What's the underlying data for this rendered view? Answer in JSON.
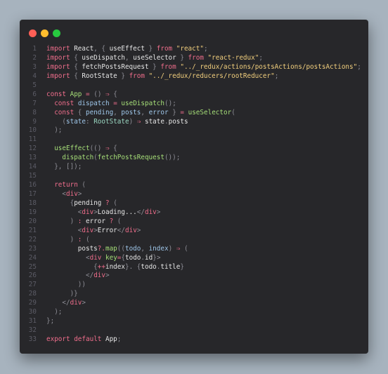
{
  "window": {
    "controls": [
      {
        "name": "close",
        "color": "#ff5f56"
      },
      {
        "name": "minimize",
        "color": "#ffbd2e"
      },
      {
        "name": "maximize",
        "color": "#27c93f"
      }
    ]
  },
  "code": {
    "lines": [
      {
        "n": "1",
        "tokens": [
          [
            "kw",
            "import"
          ],
          [
            "txt",
            " React"
          ],
          [
            "pun",
            ", { "
          ],
          [
            "txt",
            "useEffect"
          ],
          [
            "pun",
            " } "
          ],
          [
            "kw",
            "from"
          ],
          [
            "pun",
            " "
          ],
          [
            "str",
            "\"react\""
          ],
          [
            "pun",
            ";"
          ]
        ]
      },
      {
        "n": "2",
        "tokens": [
          [
            "kw",
            "import"
          ],
          [
            "pun",
            " { "
          ],
          [
            "txt",
            "useDispatch"
          ],
          [
            "pun",
            ", "
          ],
          [
            "txt",
            "useSelector"
          ],
          [
            "pun",
            " } "
          ],
          [
            "kw",
            "from"
          ],
          [
            "pun",
            " "
          ],
          [
            "str",
            "\"react-redux\""
          ],
          [
            "pun",
            ";"
          ]
        ]
      },
      {
        "n": "3",
        "tokens": [
          [
            "kw",
            "import"
          ],
          [
            "pun",
            " { "
          ],
          [
            "txt",
            "fetchPostsRequest"
          ],
          [
            "pun",
            " } "
          ],
          [
            "kw",
            "from"
          ],
          [
            "pun",
            " "
          ],
          [
            "str",
            "\"../_redux/actions/postsActions/postsActions\""
          ],
          [
            "pun",
            ";"
          ]
        ]
      },
      {
        "n": "4",
        "tokens": [
          [
            "kw",
            "import"
          ],
          [
            "pun",
            " { "
          ],
          [
            "txt",
            "RootState"
          ],
          [
            "pun",
            " } "
          ],
          [
            "kw",
            "from"
          ],
          [
            "pun",
            " "
          ],
          [
            "str",
            "\"../_redux/reducers/rootReducer\""
          ],
          [
            "pun",
            ";"
          ]
        ]
      },
      {
        "n": "5",
        "tokens": []
      },
      {
        "n": "6",
        "tokens": [
          [
            "kw",
            "const"
          ],
          [
            "txt",
            " "
          ],
          [
            "fn",
            "App"
          ],
          [
            "txt",
            " "
          ],
          [
            "op",
            "="
          ],
          [
            "pun",
            " () "
          ],
          [
            "op",
            "⇒"
          ],
          [
            "pun",
            " {"
          ]
        ]
      },
      {
        "n": "7",
        "tokens": [
          [
            "txt",
            "  "
          ],
          [
            "kw",
            "const"
          ],
          [
            "txt",
            " "
          ],
          [
            "var",
            "dispatch"
          ],
          [
            "txt",
            " "
          ],
          [
            "op",
            "="
          ],
          [
            "txt",
            " "
          ],
          [
            "fn",
            "useDispatch"
          ],
          [
            "pun",
            "();"
          ]
        ]
      },
      {
        "n": "8",
        "tokens": [
          [
            "txt",
            "  "
          ],
          [
            "kw",
            "const"
          ],
          [
            "pun",
            " { "
          ],
          [
            "var",
            "pending"
          ],
          [
            "pun",
            ", "
          ],
          [
            "var",
            "posts"
          ],
          [
            "pun",
            ", "
          ],
          [
            "var",
            "error"
          ],
          [
            "pun",
            " } "
          ],
          [
            "op",
            "="
          ],
          [
            "txt",
            " "
          ],
          [
            "fn",
            "useSelector"
          ],
          [
            "pun",
            "("
          ]
        ]
      },
      {
        "n": "9",
        "tokens": [
          [
            "pun",
            "    ("
          ],
          [
            "var",
            "state"
          ],
          [
            "pun",
            ": "
          ],
          [
            "type",
            "RootState"
          ],
          [
            "pun",
            ") "
          ],
          [
            "op",
            "⇒"
          ],
          [
            "txt",
            " state"
          ],
          [
            "pun",
            "."
          ],
          [
            "txt",
            "posts"
          ]
        ]
      },
      {
        "n": "10",
        "tokens": [
          [
            "pun",
            "  );"
          ]
        ]
      },
      {
        "n": "11",
        "tokens": []
      },
      {
        "n": "12",
        "tokens": [
          [
            "txt",
            "  "
          ],
          [
            "fn",
            "useEffect"
          ],
          [
            "pun",
            "(() "
          ],
          [
            "op",
            "⇒"
          ],
          [
            "pun",
            " {"
          ]
        ]
      },
      {
        "n": "13",
        "tokens": [
          [
            "txt",
            "    "
          ],
          [
            "fn",
            "dispatch"
          ],
          [
            "pun",
            "("
          ],
          [
            "fn",
            "fetchPostsRequest"
          ],
          [
            "pun",
            "());"
          ]
        ]
      },
      {
        "n": "14",
        "tokens": [
          [
            "pun",
            "  }, []);"
          ]
        ]
      },
      {
        "n": "15",
        "tokens": []
      },
      {
        "n": "16",
        "tokens": [
          [
            "txt",
            "  "
          ],
          [
            "kw",
            "return"
          ],
          [
            "pun",
            " ("
          ]
        ]
      },
      {
        "n": "17",
        "tokens": [
          [
            "txt",
            "    "
          ],
          [
            "pun",
            "<"
          ],
          [
            "tag",
            "div"
          ],
          [
            "pun",
            ">"
          ]
        ]
      },
      {
        "n": "18",
        "tokens": [
          [
            "txt",
            "      "
          ],
          [
            "pun",
            "{"
          ],
          [
            "txt",
            "pending "
          ],
          [
            "op",
            "?"
          ],
          [
            "pun",
            " ("
          ]
        ]
      },
      {
        "n": "19",
        "tokens": [
          [
            "txt",
            "        "
          ],
          [
            "pun",
            "<"
          ],
          [
            "tag",
            "div"
          ],
          [
            "pun",
            ">"
          ],
          [
            "txt",
            "Loading..."
          ],
          [
            "pun",
            "</"
          ],
          [
            "tag",
            "div"
          ],
          [
            "pun",
            ">"
          ]
        ]
      },
      {
        "n": "20",
        "tokens": [
          [
            "pun",
            "      ) "
          ],
          [
            "op",
            ":"
          ],
          [
            "txt",
            " error "
          ],
          [
            "op",
            "?"
          ],
          [
            "pun",
            " ("
          ]
        ]
      },
      {
        "n": "21",
        "tokens": [
          [
            "txt",
            "        "
          ],
          [
            "pun",
            "<"
          ],
          [
            "tag",
            "div"
          ],
          [
            "pun",
            ">"
          ],
          [
            "txt",
            "Error"
          ],
          [
            "pun",
            "</"
          ],
          [
            "tag",
            "div"
          ],
          [
            "pun",
            ">"
          ]
        ]
      },
      {
        "n": "22",
        "tokens": [
          [
            "pun",
            "      ) "
          ],
          [
            "op",
            ":"
          ],
          [
            "pun",
            " ("
          ]
        ]
      },
      {
        "n": "23",
        "tokens": [
          [
            "txt",
            "        posts"
          ],
          [
            "op",
            "?."
          ],
          [
            "fn",
            "map"
          ],
          [
            "pun",
            "(("
          ],
          [
            "var",
            "todo"
          ],
          [
            "pun",
            ", "
          ],
          [
            "var",
            "index"
          ],
          [
            "pun",
            ") "
          ],
          [
            "op",
            "⇒"
          ],
          [
            "pun",
            " ("
          ]
        ]
      },
      {
        "n": "24",
        "tokens": [
          [
            "txt",
            "          "
          ],
          [
            "pun",
            "<"
          ],
          [
            "tag",
            "div"
          ],
          [
            "txt",
            " "
          ],
          [
            "fn",
            "key"
          ],
          [
            "op",
            "="
          ],
          [
            "pun",
            "{"
          ],
          [
            "txt",
            "todo"
          ],
          [
            "pun",
            "."
          ],
          [
            "txt",
            "id"
          ],
          [
            "pun",
            "}>"
          ]
        ]
      },
      {
        "n": "25",
        "tokens": [
          [
            "txt",
            "            "
          ],
          [
            "pun",
            "{"
          ],
          [
            "op",
            "++"
          ],
          [
            "txt",
            "index"
          ],
          [
            "pun",
            "}. {"
          ],
          [
            "txt",
            "todo"
          ],
          [
            "pun",
            "."
          ],
          [
            "txt",
            "title"
          ],
          [
            "pun",
            "}"
          ]
        ]
      },
      {
        "n": "26",
        "tokens": [
          [
            "txt",
            "          "
          ],
          [
            "pun",
            "</"
          ],
          [
            "tag",
            "div"
          ],
          [
            "pun",
            ">"
          ]
        ]
      },
      {
        "n": "27",
        "tokens": [
          [
            "pun",
            "        ))"
          ]
        ]
      },
      {
        "n": "28",
        "tokens": [
          [
            "pun",
            "      )}"
          ]
        ]
      },
      {
        "n": "29",
        "tokens": [
          [
            "txt",
            "    "
          ],
          [
            "pun",
            "</"
          ],
          [
            "tag",
            "div"
          ],
          [
            "pun",
            ">"
          ]
        ]
      },
      {
        "n": "30",
        "tokens": [
          [
            "pun",
            "  );"
          ]
        ]
      },
      {
        "n": "31",
        "tokens": [
          [
            "pun",
            "};"
          ]
        ]
      },
      {
        "n": "32",
        "tokens": []
      },
      {
        "n": "33",
        "tokens": [
          [
            "kw",
            "export"
          ],
          [
            "txt",
            " "
          ],
          [
            "kw",
            "default"
          ],
          [
            "txt",
            " App"
          ],
          [
            "pun",
            ";"
          ]
        ]
      }
    ]
  }
}
